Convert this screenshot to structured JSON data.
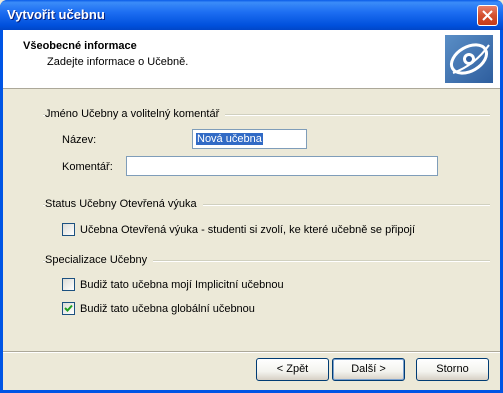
{
  "window": {
    "title": "Vytvořit učebnu"
  },
  "header": {
    "title": "Všeobecné informace",
    "subtitle": "Zadejte informace o Učebně.",
    "logo_icon": "eye-logo-icon"
  },
  "group_name": {
    "label": "Jméno Učebny a volitelný komentář",
    "name_label": "Název:",
    "name_value": "Nová učebna",
    "comment_label": "Komentář:",
    "comment_value": ""
  },
  "group_status": {
    "label": "Status Učebny Otevřená výuka",
    "open_checkbox_label": "Učebna Otevřená výuka - studenti si zvolí, ke které učebně se připojí",
    "open_checked": false
  },
  "group_specialization": {
    "label": "Specializace Učebny",
    "implicit_label": "Budiž tato učebna mojí Implicitní učebnou",
    "implicit_checked": false,
    "global_label": "Budiž tato učebna globální učebnou",
    "global_checked": true
  },
  "buttons": {
    "back": "< Zpět",
    "next": "Další >",
    "cancel": "Storno"
  },
  "colors": {
    "titlebar": "#0055E5",
    "dialog_bg": "#ECE9D8",
    "selection": "#316AC5"
  }
}
